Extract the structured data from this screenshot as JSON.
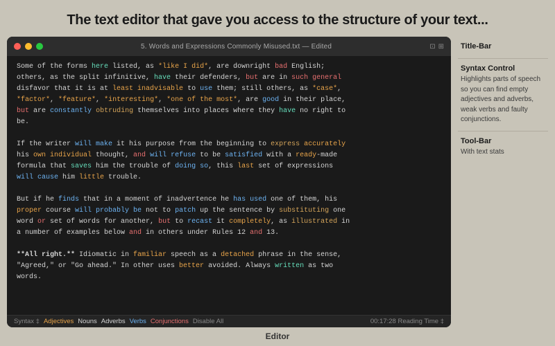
{
  "header": {
    "title": "The text editor that gave you access to the structure of your text..."
  },
  "editor": {
    "title_bar": {
      "file_name": "5. Words and Expressions Commonly Misused.txt",
      "edited_marker": "— Edited"
    },
    "content": [
      "Some of the forms here listed, as *like I did*, are downright bad English;",
      "others, as the split infinitive, have their defenders, but are in such general",
      "disfavor that it is at least inadvisable to use them; still others, as *case*,",
      "*factor*, *feature*, *interesting*, *one of the most*, are good in their place,",
      "but are constantly obtruding themselves into places where they have no right to",
      "be.",
      "",
      "If the writer will make it his purpose from the beginning to express accurately",
      "his own individual thought, and will refuse to be satisfied with a ready-made",
      "formula that saves him the trouble of doing so, this last set of expressions",
      "will cause him little trouble.",
      "",
      "But if he finds that in a moment of inadvertence he has used one of them, his",
      "proper course will probably be not to patch up the sentence by substituting one",
      "word or set of words for another, but to recast it completely, as illustrated in",
      "a number of examples below and in others under Rules 12 and 13.",
      "",
      "**All right.** Idiomatic in familiar speech as a detached phrase in the sense,",
      "\"Agreed,\" or \"Go ahead.\" In other uses better avoided. Always written as two",
      "words."
    ],
    "syntax_bar": {
      "syntax_label": "Syntax ‡",
      "adjectives": "Adjectives",
      "nouns": "Nouns",
      "adverbs": "Adverbs",
      "verbs": "Verbs",
      "conjunctions": "Conjunctions",
      "disable": "Disable All",
      "time": "00:17:28 Reading Time ‡"
    }
  },
  "sidebar": {
    "sections": [
      {
        "label": "Title-Bar",
        "desc": ""
      },
      {
        "label": "Syntax Control",
        "desc": "Highlights parts of speech so you can find empty adjectives and adverbs, weak verbs and faulty conjunctions."
      },
      {
        "label": "Tool-Bar",
        "desc": "With text stats"
      }
    ]
  },
  "bottom": {
    "label": "Editor"
  },
  "traffic_lights": {
    "red": "close",
    "yellow": "minimize",
    "green": "maximize"
  }
}
